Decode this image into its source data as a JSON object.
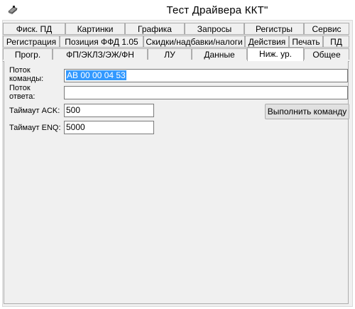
{
  "window": {
    "title": "Тест Драйвера ККТ\""
  },
  "tabs": {
    "row1": [
      "Фиск. ПД",
      "Картинки",
      "Графика",
      "Запросы",
      "Регистры",
      "Сервис"
    ],
    "row2": [
      "Регистрация",
      "Позиция ФФД 1.05",
      "Скидки/надбавки/налоги",
      "Действия",
      "Печать",
      "ПД"
    ],
    "row3": [
      "Прогр.",
      "ФП/ЭКЛЗ/ЭЖ/ФН",
      "ЛУ",
      "Данные",
      "Ниж. ур.",
      "Общее"
    ],
    "active": "Ниж. ур."
  },
  "form": {
    "command_stream_label_1": "Поток",
    "command_stream_label_2": "команды:",
    "command_stream_value": "AB 00 00 04 53",
    "response_stream_label_1": "Поток",
    "response_stream_label_2": "ответа:",
    "response_stream_value": "",
    "ack_timeout_label": "Таймаут ACK:",
    "ack_timeout_value": "500",
    "enq_timeout_label": "Таймаут ENQ:",
    "enq_timeout_value": "5000",
    "execute_button_label": "Выполнить команду"
  }
}
